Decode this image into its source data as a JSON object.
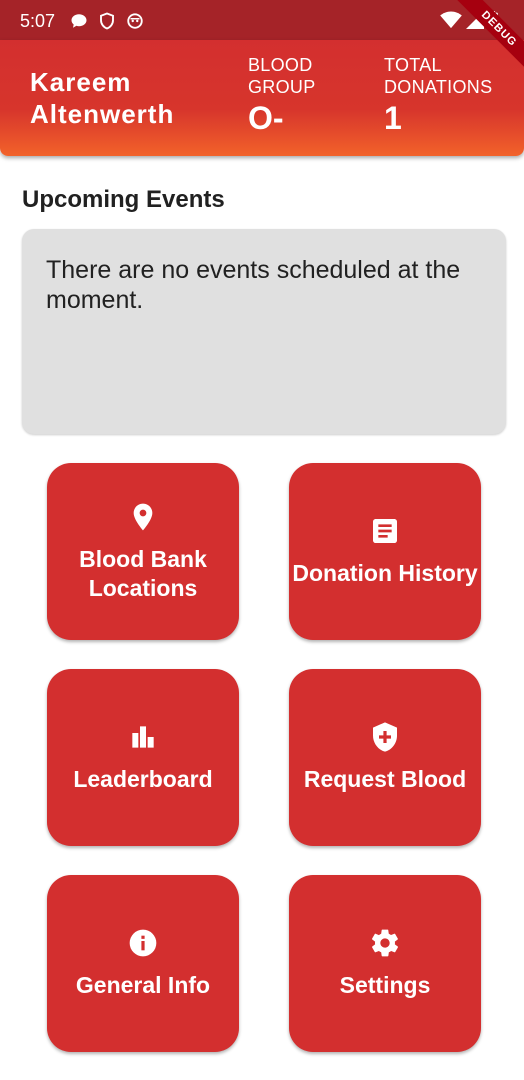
{
  "status_bar": {
    "time": "5:07",
    "icons_left": [
      "chat-bubble-icon",
      "shield-outline-icon",
      "robot-face-icon"
    ],
    "icons_right": [
      "wifi-icon",
      "cell-signal-icon",
      "battery-icon"
    ]
  },
  "debug_banner": "DEBUG",
  "header": {
    "user_name": "Kareem Altenwerth",
    "blood_group_label": "BLOOD GROUP",
    "blood_group_value": "O-",
    "total_donations_label": "TOTAL DONATIONS",
    "total_donations_value": "1"
  },
  "events": {
    "title": "Upcoming Events",
    "empty_message": "There are no events scheduled at the moment."
  },
  "tiles": [
    {
      "label": "Blood Bank Locations",
      "icon": "location-pin-icon"
    },
    {
      "label": "Donation History",
      "icon": "document-icon"
    },
    {
      "label": "Leaderboard",
      "icon": "bar-chart-icon"
    },
    {
      "label": "Request Blood",
      "icon": "shield-plus-icon"
    },
    {
      "label": "General Info",
      "icon": "info-icon"
    },
    {
      "label": "Settings",
      "icon": "gear-icon"
    }
  ],
  "colors": {
    "primary": "#d32f2f",
    "status_bar": "#a52328",
    "header_gradient_end": "#f2622a",
    "card_bg": "#e0e0e0"
  }
}
